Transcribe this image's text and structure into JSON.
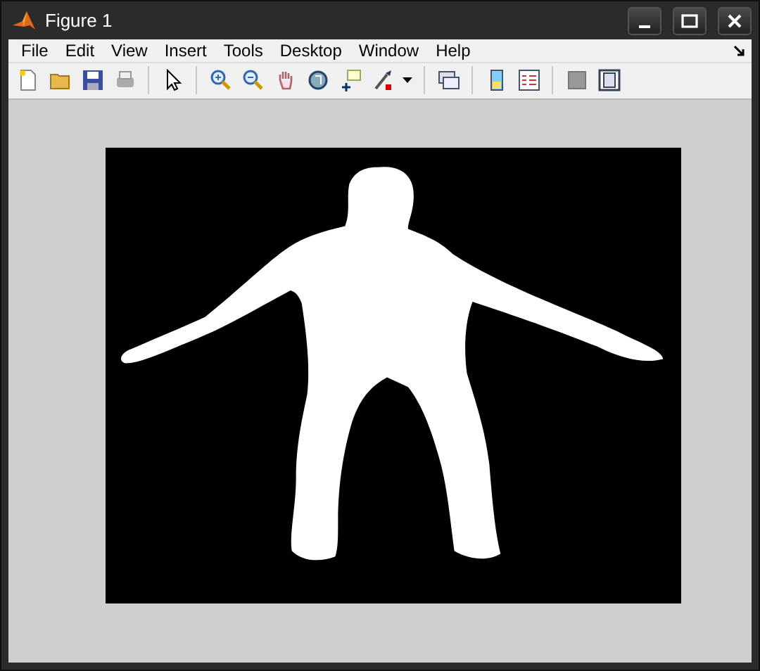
{
  "window": {
    "title": "Figure 1"
  },
  "menu": [
    "File",
    "Edit",
    "View",
    "Insert",
    "Tools",
    "Desktop",
    "Window",
    "Help"
  ]
}
